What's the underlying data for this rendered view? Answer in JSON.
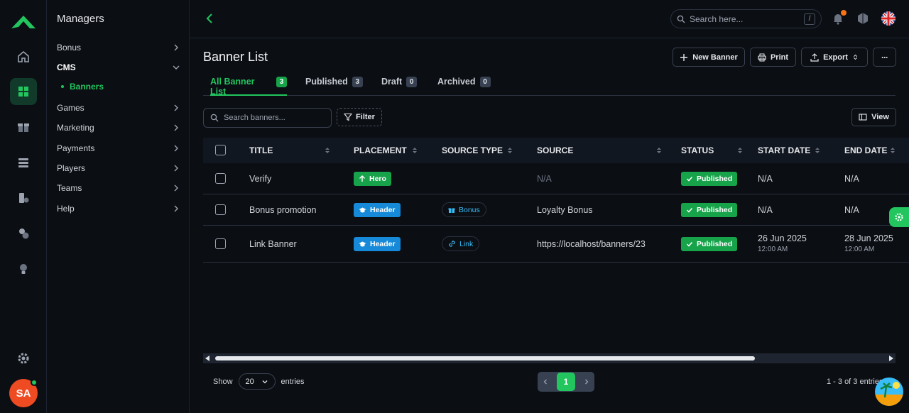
{
  "sidebar": {
    "title": "Managers",
    "items": [
      {
        "label": "Bonus"
      },
      {
        "label": "CMS"
      },
      {
        "label": "Games"
      },
      {
        "label": "Marketing"
      },
      {
        "label": "Payments"
      },
      {
        "label": "Players"
      },
      {
        "label": "Teams"
      },
      {
        "label": "Help"
      }
    ],
    "sub_item": "Banners"
  },
  "user": {
    "initials": "SA"
  },
  "topbar": {
    "search_placeholder": "Search here...",
    "search_shortcut": "/"
  },
  "page": {
    "title": "Banner List"
  },
  "actions": {
    "new": "New Banner",
    "print": "Print",
    "export": "Export",
    "more": "···"
  },
  "tabs": [
    {
      "label": "All Banner List",
      "count": "3"
    },
    {
      "label": "Published",
      "count": "3"
    },
    {
      "label": "Draft",
      "count": "0"
    },
    {
      "label": "Archived",
      "count": "0"
    }
  ],
  "toolbar": {
    "search_placeholder": "Search banners...",
    "filter": "Filter",
    "view": "View"
  },
  "table": {
    "columns": [
      "TITLE",
      "PLACEMENT",
      "SOURCE TYPE",
      "SOURCE",
      "STATUS",
      "START DATE",
      "END DATE"
    ],
    "rows": [
      {
        "title": "Verify",
        "placement": "Hero",
        "source_type": "",
        "source": "N/A",
        "status": "Published",
        "start_date": "N/A",
        "start_time": "",
        "end_date": "N/A",
        "end_time": ""
      },
      {
        "title": "Bonus promotion",
        "placement": "Header",
        "source_type": "Bonus",
        "source": "Loyalty Bonus",
        "status": "Published",
        "start_date": "N/A",
        "start_time": "",
        "end_date": "N/A",
        "end_time": ""
      },
      {
        "title": "Link Banner",
        "placement": "Header",
        "source_type": "Link",
        "source": "https://localhost/banners/23",
        "status": "Published",
        "start_date": "26 Jun 2025",
        "start_time": "12:00 AM",
        "end_date": "28 Jun 2025",
        "end_time": "12:00 AM"
      }
    ]
  },
  "footer": {
    "show": "Show",
    "page_size": "20",
    "entries": "entries",
    "current_page": "1",
    "info": "1 - 3 of 3 entries"
  },
  "colors": {
    "accent": "#22c55e",
    "header_pill": "#1689d8",
    "bg": "#0b0e13"
  }
}
